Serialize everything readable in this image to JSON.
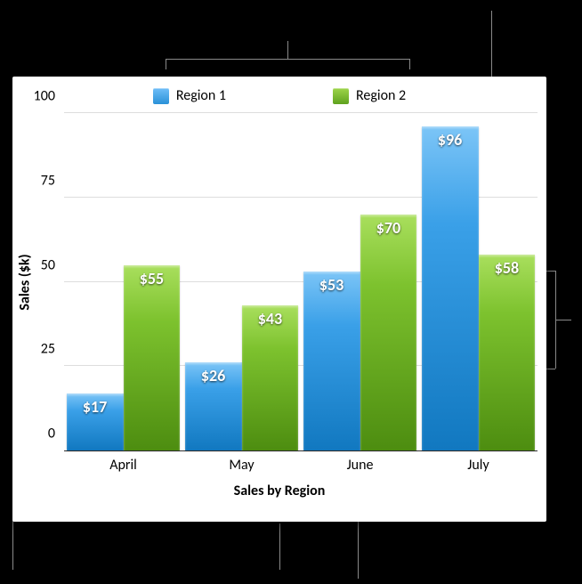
{
  "chart_data": {
    "type": "bar",
    "title": "Sales by Region",
    "xlabel": "Sales by Region",
    "ylabel": "Sales ($k)",
    "ylim": [
      0,
      100
    ],
    "yticks": [
      0,
      25,
      50,
      75,
      100
    ],
    "categories": [
      "April",
      "May",
      "June",
      "July"
    ],
    "series": [
      {
        "name": "Region 1",
        "color": "#2a91d8",
        "values": [
          17,
          26,
          53,
          96
        ]
      },
      {
        "name": "Region 2",
        "color": "#5fa21e",
        "values": [
          55,
          43,
          70,
          58
        ]
      }
    ],
    "value_format": "${v}"
  },
  "legend": {
    "series1": "Region 1",
    "series2": "Region 2"
  },
  "yaxis": {
    "label": "Sales ($k)",
    "t0": "0",
    "t25": "25",
    "t50": "50",
    "t75": "75",
    "t100": "100"
  },
  "xaxis": {
    "c0": "April",
    "c1": "May",
    "c2": "June",
    "c3": "July",
    "title": "Sales by Region"
  },
  "labels": {
    "april_r1": "$17",
    "april_r2": "$55",
    "may_r1": "$26",
    "may_r2": "$43",
    "june_r1": "$53",
    "june_r2": "$70",
    "july_r1": "$96",
    "july_r2": "$58"
  }
}
